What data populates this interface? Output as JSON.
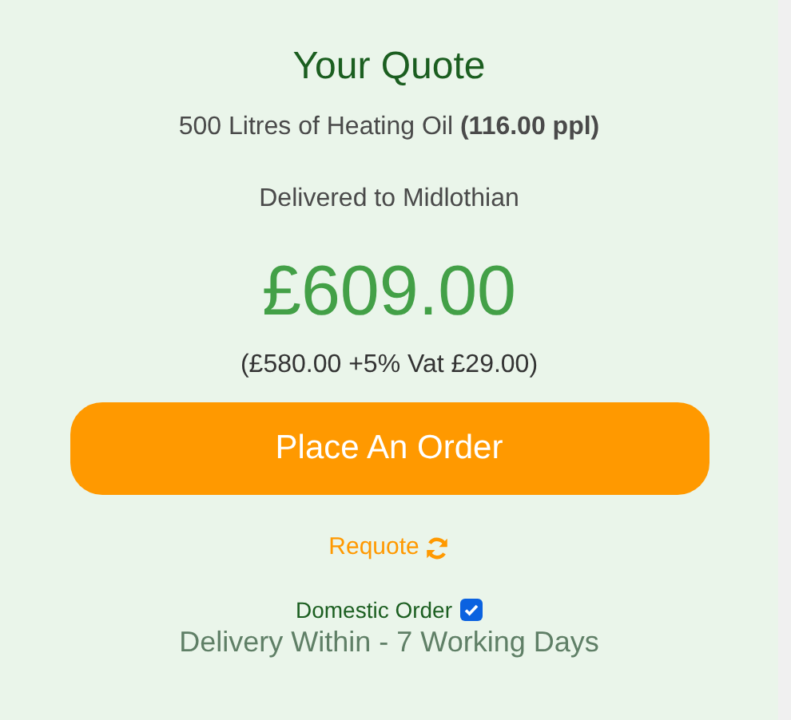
{
  "quote": {
    "title": "Your Quote",
    "product": "500 Litres of Heating Oil **(116.00 ppl)**",
    "delivered_to": "Delivered to Midlothian",
    "price": "£609.00",
    "breakdown": "(£580.00 +5% Vat £29.00)"
  },
  "order_button": "Place An Order",
  "requote_link": "Requote",
  "domestic_order": {
    "label": "Domestic Order",
    "checked": true
  },
  "delivery": "Delivery Within - 7 Working Days"
}
